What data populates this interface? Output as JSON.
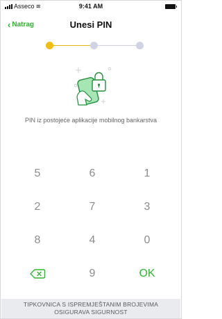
{
  "status_bar": {
    "carrier": "Asseco",
    "time": "9:41 AM"
  },
  "nav": {
    "back_label": "Natrag",
    "title": "Unesi PIN"
  },
  "stepper": {
    "current_step": 1,
    "total_steps": 3
  },
  "description": "PIN iz postojeće aplikacije mobilnog bankarstva",
  "keypad": {
    "rows": [
      [
        "5",
        "6",
        "1"
      ],
      [
        "2",
        "7",
        "3"
      ],
      [
        "8",
        "4",
        "0"
      ]
    ],
    "last_row": {
      "middle": "9",
      "ok_label": "OK",
      "delete_icon": "backspace-icon"
    }
  },
  "footer": {
    "line1": "TIPKOVNICA S ISPREMJEŠTANIM BROJEVIMA",
    "line2": "OSIGURAVA SIGURNOST"
  },
  "colors": {
    "accent": "#2fb52f",
    "step_active": "#f1bd10",
    "step_inactive": "#cfd3e3"
  }
}
